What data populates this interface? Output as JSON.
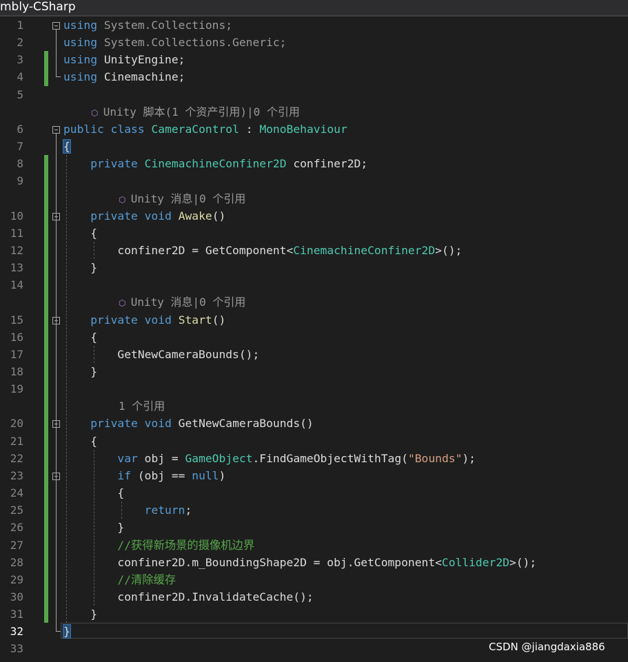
{
  "tab": {
    "title": "mbly-CSharp"
  },
  "watermark": "CSDN @jiangdaxia886",
  "colors": {
    "keyword": "#569cd6",
    "type": "#4ec9b0",
    "string": "#d69d85",
    "comment": "#57a64a",
    "text": "#dcdcdc",
    "line_number": "#858585",
    "change_bar": "#57a64a",
    "codelens_icon": "#b180d7"
  },
  "codelens": {
    "class_refs": "Unity 脚本(1 个资产引用)|0 个引用",
    "awake_refs": "Unity 消息|0 个引用",
    "start_refs": "Unity 消息|0 个引用",
    "bounds_refs": "1 个引用",
    "icon": "unity-cube-icon"
  },
  "lines": [
    {
      "n": "1",
      "parts": [
        [
          "kw",
          "using"
        ],
        [
          "dim",
          " System.Collections;"
        ]
      ]
    },
    {
      "n": "2",
      "parts": [
        [
          "kw",
          "using"
        ],
        [
          "dim",
          " System.Collections.Generic;"
        ]
      ]
    },
    {
      "n": "3",
      "parts": [
        [
          "kw",
          "using"
        ],
        [
          "tx",
          " UnityEngine;"
        ]
      ]
    },
    {
      "n": "4",
      "parts": [
        [
          "kw",
          "using"
        ],
        [
          "tx",
          " Cinemachine;"
        ]
      ]
    },
    {
      "n": "5",
      "parts": []
    },
    {
      "n": "6",
      "parts": [
        [
          "kw",
          "public"
        ],
        [
          "tx",
          " "
        ],
        [
          "kw",
          "class"
        ],
        [
          "tx",
          " "
        ],
        [
          "ty",
          "CameraControl"
        ],
        [
          "tx",
          " : "
        ],
        [
          "ty",
          "MonoBehaviour"
        ]
      ]
    },
    {
      "n": "7",
      "parts": [
        [
          "bh",
          "{"
        ]
      ]
    },
    {
      "n": "8",
      "parts": [
        [
          "tx",
          "    "
        ],
        [
          "kw",
          "private"
        ],
        [
          "tx",
          " "
        ],
        [
          "ty",
          "CinemachineConfiner2D"
        ],
        [
          "tx",
          " confiner2D;"
        ]
      ]
    },
    {
      "n": "9",
      "parts": []
    },
    {
      "n": "10",
      "parts": [
        [
          "tx",
          "    "
        ],
        [
          "kw",
          "private"
        ],
        [
          "tx",
          " "
        ],
        [
          "kw",
          "void"
        ],
        [
          "tx",
          " "
        ],
        [
          "fn",
          "Awake"
        ],
        [
          "tx",
          "()"
        ]
      ]
    },
    {
      "n": "11",
      "parts": [
        [
          "tx",
          "    {"
        ]
      ]
    },
    {
      "n": "12",
      "parts": [
        [
          "tx",
          "        confiner2D = GetComponent<"
        ],
        [
          "ty",
          "CinemachineConfiner2D"
        ],
        [
          "tx",
          ">();"
        ]
      ]
    },
    {
      "n": "13",
      "parts": [
        [
          "tx",
          "    }"
        ]
      ]
    },
    {
      "n": "14",
      "parts": []
    },
    {
      "n": "15",
      "parts": [
        [
          "tx",
          "    "
        ],
        [
          "kw",
          "private"
        ],
        [
          "tx",
          " "
        ],
        [
          "kw",
          "void"
        ],
        [
          "tx",
          " "
        ],
        [
          "fn",
          "Start"
        ],
        [
          "tx",
          "()"
        ]
      ]
    },
    {
      "n": "16",
      "parts": [
        [
          "tx",
          "    {"
        ]
      ]
    },
    {
      "n": "17",
      "parts": [
        [
          "tx",
          "        GetNewCameraBounds();"
        ]
      ]
    },
    {
      "n": "18",
      "parts": [
        [
          "tx",
          "    }"
        ]
      ]
    },
    {
      "n": "19",
      "parts": []
    },
    {
      "n": "20",
      "parts": [
        [
          "tx",
          "    "
        ],
        [
          "kw",
          "private"
        ],
        [
          "tx",
          " "
        ],
        [
          "kw",
          "void"
        ],
        [
          "tx",
          " GetNewCameraBounds()"
        ]
      ]
    },
    {
      "n": "21",
      "parts": [
        [
          "tx",
          "    {"
        ]
      ]
    },
    {
      "n": "22",
      "parts": [
        [
          "tx",
          "        "
        ],
        [
          "kw",
          "var"
        ],
        [
          "tx",
          " obj = "
        ],
        [
          "ty",
          "GameObject"
        ],
        [
          "tx",
          ".FindGameObjectWithTag("
        ],
        [
          "st",
          "\"Bounds\""
        ],
        [
          "tx",
          ");"
        ]
      ]
    },
    {
      "n": "23",
      "parts": [
        [
          "tx",
          "        "
        ],
        [
          "kw",
          "if"
        ],
        [
          "tx",
          " (obj == "
        ],
        [
          "kw",
          "null"
        ],
        [
          "tx",
          ")"
        ]
      ]
    },
    {
      "n": "24",
      "parts": [
        [
          "tx",
          "        {"
        ]
      ]
    },
    {
      "n": "25",
      "parts": [
        [
          "tx",
          "            "
        ],
        [
          "kw",
          "return"
        ],
        [
          "tx",
          ";"
        ]
      ]
    },
    {
      "n": "26",
      "parts": [
        [
          "tx",
          "        }"
        ]
      ]
    },
    {
      "n": "27",
      "parts": [
        [
          "tx",
          "        "
        ],
        [
          "cm",
          "//获得新场景的摄像机边界"
        ]
      ]
    },
    {
      "n": "28",
      "parts": [
        [
          "tx",
          "        confiner2D.m_BoundingShape2D = obj.GetComponent<"
        ],
        [
          "ty",
          "Collider2D"
        ],
        [
          "tx",
          ">();"
        ]
      ]
    },
    {
      "n": "29",
      "parts": [
        [
          "tx",
          "        "
        ],
        [
          "cm",
          "//清除缓存"
        ]
      ]
    },
    {
      "n": "30",
      "parts": [
        [
          "tx",
          "        confiner2D.InvalidateCache();"
        ]
      ]
    },
    {
      "n": "31",
      "parts": [
        [
          "tx",
          "    }"
        ]
      ]
    },
    {
      "n": "32",
      "parts": [
        [
          "bh",
          "}"
        ]
      ]
    },
    {
      "n": "33",
      "parts": []
    }
  ]
}
